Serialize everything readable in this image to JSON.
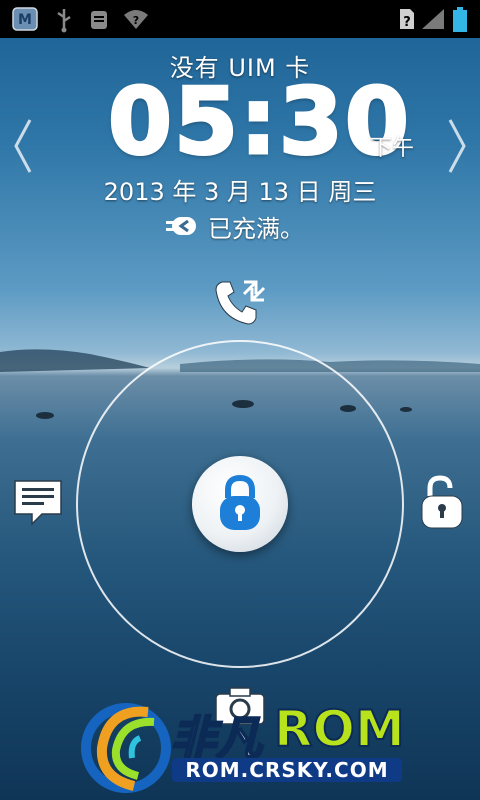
{
  "status_bar": {
    "left_icons": [
      "m-app-icon",
      "usb-icon",
      "android-debug-icon",
      "wifi-question-icon"
    ],
    "right_icons": [
      "no-sim-icon",
      "signal-icon",
      "battery-icon"
    ]
  },
  "lockscreen": {
    "carrier_text": "没有 UIM 卡",
    "time": "05:30",
    "ampm": "下午",
    "date": "2013 年 3 月 13 日 周三",
    "charge_status": "已充满。"
  },
  "unlock_targets": [
    "call-icon",
    "message-icon",
    "unlock-icon",
    "camera-icon"
  ],
  "watermark": {
    "brand_cn": "非凡",
    "brand_rom": "ROM",
    "url": "ROM.CRSKY.COM"
  },
  "colors": {
    "lock_blue": "#1e7fd9",
    "status_bar": "#000000",
    "battery": "#33b5e5"
  }
}
